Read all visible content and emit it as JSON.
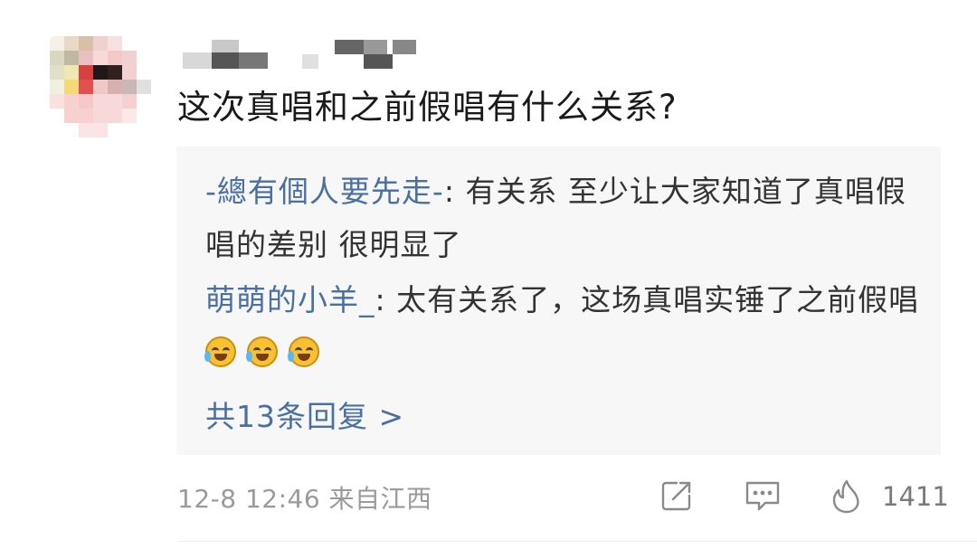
{
  "comment": {
    "text": "这次真唱和之前假唱有什么关系?",
    "time": "12-8 12:46",
    "location": "来自江西",
    "like_count": "1411"
  },
  "replies": [
    {
      "user": "-總有個人要先走-",
      "sep": ": ",
      "text": "有关系 至少让大家知道了真唱假唱的差别  很明显了"
    },
    {
      "user": "萌萌的小羊_",
      "sep": ": ",
      "text": "太有关系了，这场真唱实锤了之前假唱",
      "emojis": [
        "crying-laughing-emoji",
        "crying-laughing-emoji",
        "crying-laughing-emoji"
      ]
    }
  ],
  "more_replies_label": "共13条回复 >",
  "icons": {
    "share": "share-icon",
    "comment": "comment-icon",
    "like": "flame-like-icon"
  },
  "colors": {
    "link": "#4a6fa1",
    "reply_bg": "#f7f7f7",
    "meta": "#9a9a9a"
  }
}
